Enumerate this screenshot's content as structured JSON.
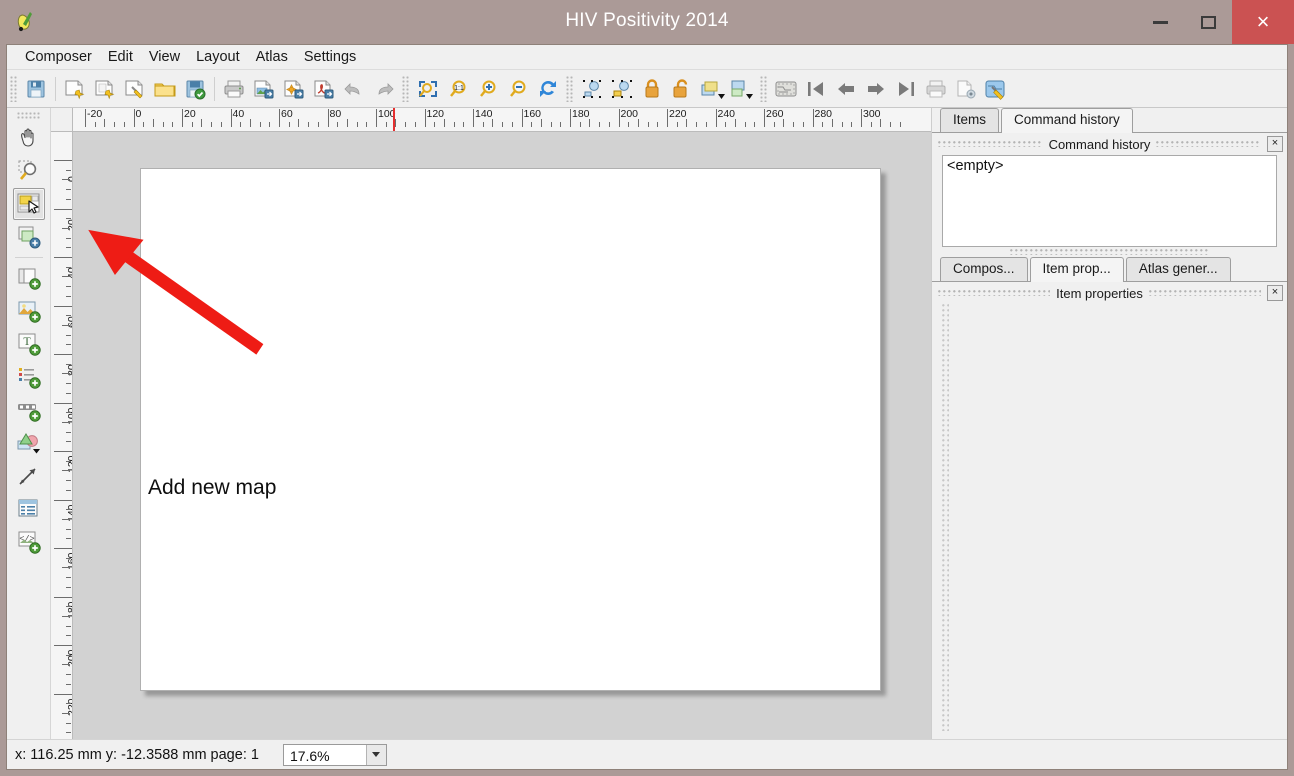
{
  "window": {
    "title": "HIV Positivity 2014",
    "logo_icon": "qgis-logo-icon",
    "buttons": {
      "minimize": "–",
      "maximize": "☐",
      "close": "×"
    }
  },
  "menubar": {
    "items": [
      {
        "label": "Composer"
      },
      {
        "label": "Edit"
      },
      {
        "label": "View"
      },
      {
        "label": "Layout"
      },
      {
        "label": "Atlas"
      },
      {
        "label": "Settings"
      }
    ]
  },
  "toolbar": {
    "groups": [
      {
        "name": "file",
        "buttons": [
          {
            "icon": "save-project-icon",
            "label": "Save Project"
          }
        ]
      },
      {
        "name": "composer",
        "buttons": [
          {
            "icon": "new-composer-icon",
            "label": "New Composer"
          },
          {
            "icon": "duplicate-composer-icon",
            "label": "Duplicate Composer"
          },
          {
            "icon": "composer-manager-icon",
            "label": "Composer Manager"
          },
          {
            "icon": "load-from-template-icon",
            "label": "Load from template"
          },
          {
            "icon": "save-as-template-icon",
            "label": "Save as template"
          }
        ]
      },
      {
        "name": "export",
        "buttons": [
          {
            "icon": "print-icon",
            "label": "Print"
          },
          {
            "icon": "export-image-icon",
            "label": "Export as Image"
          },
          {
            "icon": "export-svg-icon",
            "label": "Export as SVG"
          },
          {
            "icon": "export-pdf-icon",
            "label": "Export as PDF"
          },
          {
            "icon": "undo-icon",
            "label": "Undo"
          },
          {
            "icon": "redo-icon",
            "label": "Redo"
          }
        ]
      },
      {
        "name": "navigation",
        "buttons": [
          {
            "icon": "zoom-full-icon",
            "label": "Zoom full"
          },
          {
            "icon": "zoom-100-icon",
            "label": "Zoom 100%"
          },
          {
            "icon": "zoom-in-icon",
            "label": "Zoom in"
          },
          {
            "icon": "zoom-out-icon",
            "label": "Zoom out"
          },
          {
            "icon": "refresh-icon",
            "label": "Refresh view"
          }
        ]
      },
      {
        "name": "items",
        "buttons": [
          {
            "icon": "group-items-icon",
            "label": "Group items"
          },
          {
            "icon": "ungroup-items-icon",
            "label": "Ungroup items"
          },
          {
            "icon": "lock-items-icon",
            "label": "Lock selected items"
          },
          {
            "icon": "unlock-items-icon",
            "label": "Unlock all items"
          },
          {
            "icon": "raise-items-icon",
            "label": "Raise selected items"
          },
          {
            "icon": "lower-items-icon",
            "label": "Lower selected items"
          }
        ]
      },
      {
        "name": "atlas",
        "buttons": [
          {
            "icon": "atlas-preview-icon",
            "label": "Preview Atlas"
          },
          {
            "icon": "atlas-first-icon",
            "label": "First feature"
          },
          {
            "icon": "atlas-previous-icon",
            "label": "Previous feature"
          },
          {
            "icon": "atlas-next-icon",
            "label": "Next feature"
          },
          {
            "icon": "atlas-last-icon",
            "label": "Last feature"
          },
          {
            "icon": "atlas-print-icon",
            "label": "Print Atlas"
          },
          {
            "icon": "atlas-export-image-icon",
            "label": "Export Atlas as Image"
          },
          {
            "icon": "atlas-settings-icon",
            "label": "Atlas settings"
          }
        ]
      }
    ]
  },
  "lefttools": {
    "items": [
      {
        "icon": "pan-hand-icon",
        "label": "Pan layout",
        "active": false
      },
      {
        "icon": "zoom-magnifier-icon",
        "label": "Zoom",
        "active": false
      },
      {
        "icon": "select-move-item-icon",
        "label": "Select / Move item",
        "active": true
      },
      {
        "icon": "move-item-content-icon",
        "label": "Move item content",
        "active": false
      },
      {
        "icon": "add-new-map-icon",
        "label": "Add new map",
        "active": false
      },
      {
        "icon": "add-image-icon",
        "label": "Add image",
        "active": false
      },
      {
        "icon": "add-label-icon",
        "label": "Add new label",
        "active": false
      },
      {
        "icon": "add-legend-icon",
        "label": "Add new legend",
        "active": false
      },
      {
        "icon": "add-scalebar-icon",
        "label": "Add new scalebar",
        "active": false
      },
      {
        "icon": "add-shape-icon",
        "label": "Add shape",
        "active": false
      },
      {
        "icon": "add-arrow-icon",
        "label": "Add arrow",
        "active": false
      },
      {
        "icon": "add-attribute-table-icon",
        "label": "Add attribute table",
        "active": false
      },
      {
        "icon": "add-html-frame-icon",
        "label": "Add HTML frame",
        "active": false
      }
    ]
  },
  "annotation": {
    "text": "Add new map",
    "arrow_color": "#ee1c15",
    "target_icon": "add-new-map-icon"
  },
  "rulers": {
    "unit": "mm",
    "horizontal": {
      "labels": [
        "-20",
        "0",
        "20",
        "40",
        "60",
        "80",
        "100",
        "120",
        "140",
        "160",
        "180",
        "200",
        "220",
        "240",
        "260",
        "280",
        "300"
      ],
      "marker_value": "110"
    },
    "vertical": {
      "labels": [
        "0",
        "20",
        "40",
        "60",
        "80",
        "100",
        "120",
        "140",
        "160",
        "180",
        "200",
        "220"
      ],
      "marker_value": "-12"
    }
  },
  "canvas": {
    "page_color": "#ffffff",
    "background_color": "#d2d2d2"
  },
  "rightdock": {
    "top": {
      "tabs": [
        {
          "label": "Items",
          "selected": false
        },
        {
          "label": "Command history",
          "selected": true
        }
      ],
      "panel_title": "Command history",
      "close_glyph": "×",
      "list_value": "<empty>"
    },
    "bottom": {
      "tabs": [
        {
          "label": "Compos...",
          "selected": false
        },
        {
          "label": "Item prop...",
          "selected": true
        },
        {
          "label": "Atlas gener...",
          "selected": false
        }
      ],
      "panel_title": "Item properties",
      "close_glyph": "×"
    }
  },
  "statusbar": {
    "coordinates": "x: 116.25 mm y: -12.3588 mm page: 1",
    "zoom_value": "17.6%",
    "zoom_caret_icon": "chevron-down-icon"
  },
  "colors": {
    "titlebar": "#ab9a97",
    "close_button": "#cb5252",
    "chrome": "#f0f0f0",
    "canvas_bg": "#d2d2d2",
    "annotation_red": "#ee1c15"
  }
}
